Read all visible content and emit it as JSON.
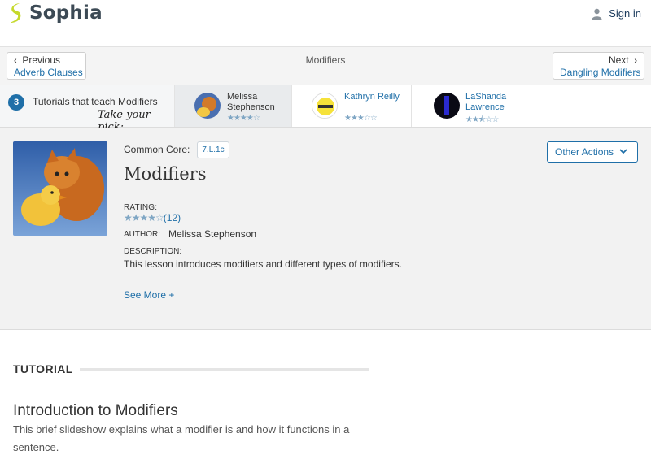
{
  "brand": {
    "name": "Sophia",
    "color": "#3c4a55",
    "accent": "#c5d92c"
  },
  "header": {
    "signin_label": "Sign in",
    "signin_icon": "user-icon"
  },
  "nav": {
    "prev_small": "Previous",
    "prev_link": "Adverb Clauses",
    "next_small": "Next",
    "next_link": "Dangling Modifiers",
    "title": "Modifiers"
  },
  "tutorials": {
    "count": "3",
    "intro": "Tutorials that teach Modifiers",
    "pick": "Take your pick:",
    "cards": [
      {
        "name": "Melissa Stephenson",
        "rating": 4,
        "stars": "★★★★☆"
      },
      {
        "name": "Kathryn Reilly",
        "rating": 3,
        "stars": "★★★☆☆"
      },
      {
        "name": "LaShanda Lawrence",
        "rating": 2.5,
        "stars": "★★⯪☆☆"
      }
    ]
  },
  "lesson": {
    "common_core_label": "Common Core:",
    "common_core_tag": "7.L.1c",
    "title": "Modifiers",
    "rating_label": "RATING:",
    "rating_stars": "★★★★☆",
    "rating_value": 4,
    "rating_count": "(12)",
    "author_label": "AUTHOR:",
    "author_name": "Melissa Stephenson",
    "description_label": "DESCRIPTION:",
    "description": "This lesson introduces modifiers and different types of modifiers.",
    "see_more": "See More +",
    "other_actions": "Other Actions"
  },
  "tutorial": {
    "section_label": "TUTORIAL",
    "title": "Introduction to Modifiers",
    "text": "This brief slideshow explains what a modifier is and how it functions in a sentence."
  },
  "colors": {
    "link": "#1f6fa8",
    "stars": "#7fa6c4",
    "lesson_bg": "#f2f2f2"
  }
}
